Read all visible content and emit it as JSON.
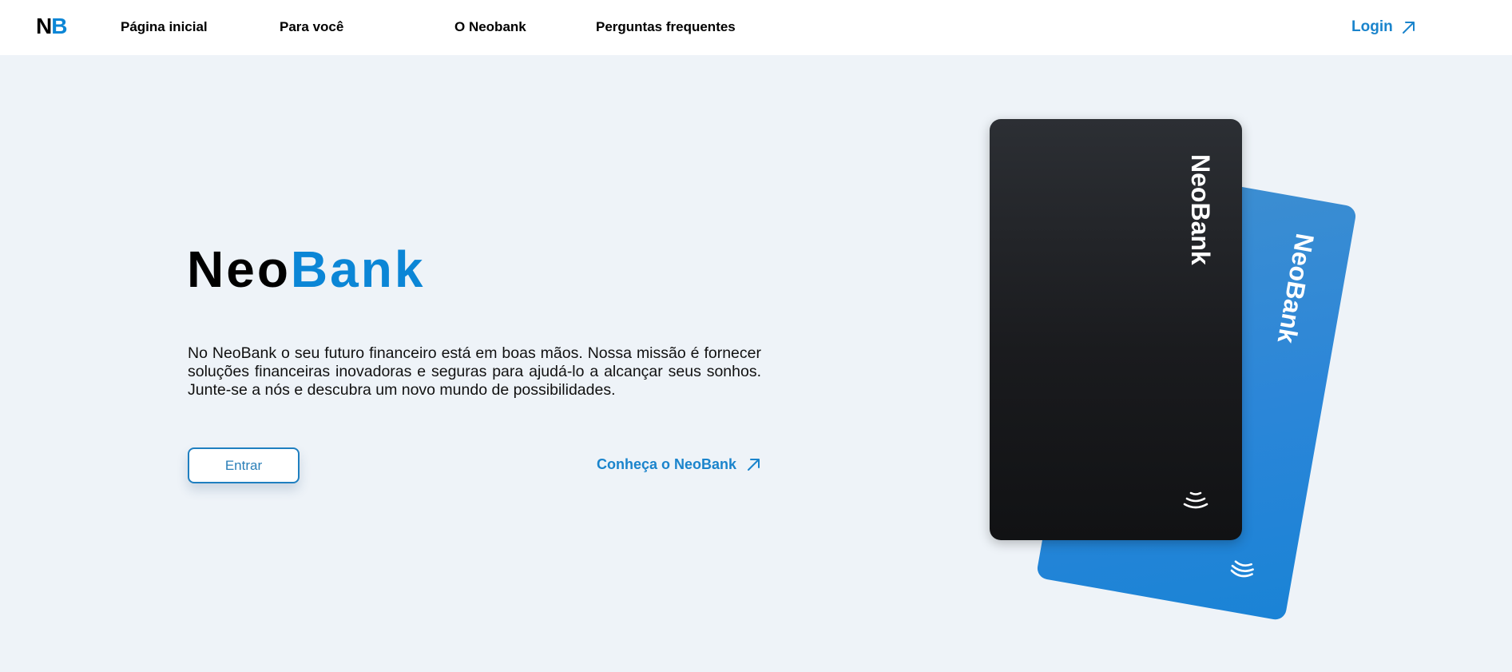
{
  "header": {
    "logo": {
      "n": "N",
      "b": "B"
    },
    "nav": [
      "Página inicial",
      "Para você",
      "O Neobank",
      "Perguntas frequentes"
    ],
    "login_label": "Login"
  },
  "hero": {
    "title_part1": "Neo",
    "title_part2": "Bank",
    "description": "No NeoBank o seu futuro financeiro está em boas mãos. Nossa missão é fornecer soluções financeiras inovadoras e seguras para ajudá-lo a alcançar seus sonhos. Junte-se a nós e descubra um novo mundo de possibilidades.",
    "enter_button": "Entrar",
    "learn_more_link": "Conheça o NeoBank"
  },
  "cards": {
    "front_brand": "NeoBank",
    "back_brand": "NeoBank",
    "front_color": "#1a1b1e",
    "back_color": "#2b86d8",
    "icons": [
      "contactless-icon"
    ]
  },
  "colors": {
    "accent": "#0b86d6",
    "background": "#eef3f8",
    "header": "#ffffff"
  }
}
